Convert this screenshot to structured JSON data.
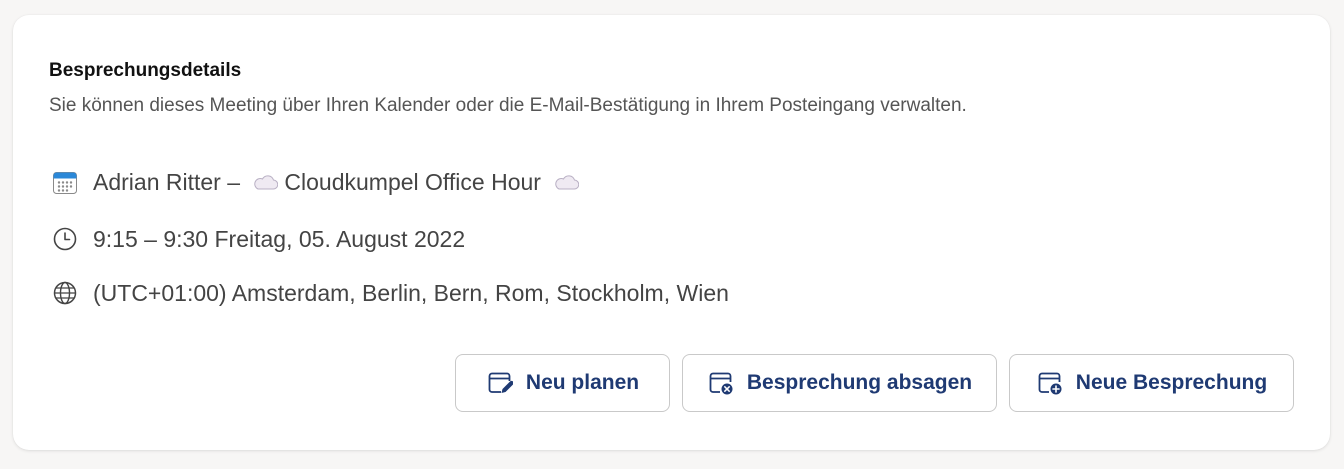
{
  "details": {
    "title": "Besprechungsdetails",
    "subtitle": "Sie können dieses Meeting über Ihren Kalender oder die E-Mail-Bestätigung in Ihrem Posteingang verwalten.",
    "meeting_host": "Adrian Ritter –",
    "meeting_name": "Cloudkumpel Office Hour",
    "time": "9:15 – 9:30 Freitag, 05. August 2022",
    "timezone": "(UTC+01:00) Amsterdam, Berlin, Bern, Rom, Stockholm, Wien"
  },
  "icons": {
    "calendar": "calendar-icon",
    "cloud": "cloud-icon",
    "clock": "clock-icon",
    "globe": "globe-icon",
    "reschedule": "calendar-edit-icon",
    "cancel": "calendar-cancel-icon",
    "new": "calendar-add-icon"
  },
  "buttons": {
    "reschedule_label": "Neu planen",
    "cancel_label": "Besprechung absagen",
    "new_label": "Neue Besprechung"
  },
  "colors": {
    "accent": "#1f3a73",
    "calendar_blue": "#2b88d8",
    "text_secondary": "#555555"
  }
}
